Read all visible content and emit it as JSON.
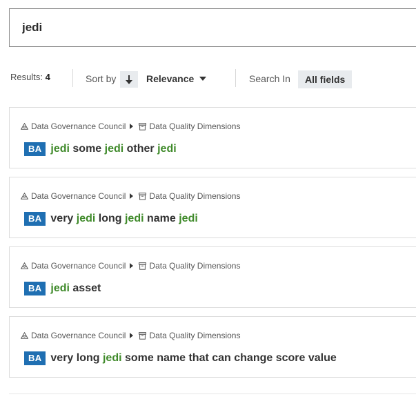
{
  "search": {
    "value": "jedi",
    "placeholder": ""
  },
  "toolbar": {
    "results_label": "Results:",
    "results_count": "4",
    "sort_by_label": "Sort by",
    "sort_direction_icon": "arrow-down-icon",
    "sort_value": "Relevance",
    "search_in_label": "Search In",
    "search_in_value": "All fields"
  },
  "results": [
    {
      "community": "Data Governance Council",
      "domain": "Data Quality Dimensions",
      "badge": "BA",
      "title_parts": [
        {
          "text": "jedi",
          "highlight": true
        },
        {
          "text": " some ",
          "highlight": false
        },
        {
          "text": "jedi",
          "highlight": true
        },
        {
          "text": " other ",
          "highlight": false
        },
        {
          "text": "jedi",
          "highlight": true
        }
      ]
    },
    {
      "community": "Data Governance Council",
      "domain": "Data Quality Dimensions",
      "badge": "BA",
      "title_parts": [
        {
          "text": "very ",
          "highlight": false
        },
        {
          "text": "jedi",
          "highlight": true
        },
        {
          "text": " long ",
          "highlight": false
        },
        {
          "text": "jedi",
          "highlight": true
        },
        {
          "text": " name ",
          "highlight": false
        },
        {
          "text": "jedi",
          "highlight": true
        }
      ]
    },
    {
      "community": "Data Governance Council",
      "domain": "Data Quality Dimensions",
      "badge": "BA",
      "title_parts": [
        {
          "text": "jedi",
          "highlight": true
        },
        {
          "text": " asset",
          "highlight": false
        }
      ]
    },
    {
      "community": "Data Governance Council",
      "domain": "Data Quality Dimensions",
      "badge": "BA",
      "title_parts": [
        {
          "text": "very long ",
          "highlight": false
        },
        {
          "text": "jedi",
          "highlight": true
        },
        {
          "text": " some name that can change score value",
          "highlight": false
        }
      ]
    }
  ],
  "colors": {
    "badge": "#1f6fb2",
    "highlight": "#3f8a2a",
    "chip_bg": "#e8ebee",
    "border": "#dcdcdc"
  },
  "icons": {
    "community": "community-icon",
    "domain": "domain-icon"
  }
}
